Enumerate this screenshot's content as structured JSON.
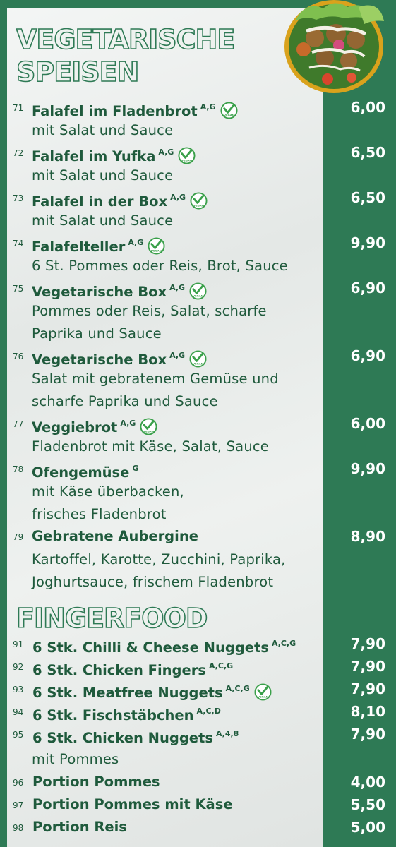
{
  "sections": {
    "vegetarian": {
      "title_line1": "VEGETARISCHE",
      "title_line2": "SPEISEN"
    },
    "fingerfood": {
      "title": "FINGERFOOD"
    }
  },
  "vegan_badge": "VEGAN",
  "vegetarian_items": [
    {
      "num": "71",
      "name": "Falafel im Fladenbrot",
      "allergens": "A,G",
      "vegan": true,
      "price": "6,00",
      "desc": [
        "mit Salat und Sauce"
      ]
    },
    {
      "num": "72",
      "name": "Falafel im Yufka",
      "allergens": "A,G",
      "vegan": true,
      "price": "6,50",
      "desc": [
        "mit Salat und Sauce"
      ]
    },
    {
      "num": "73",
      "name": "Falafel in der Box",
      "allergens": "A,G",
      "vegan": true,
      "price": "6,50",
      "desc": [
        "mit Salat und Sauce"
      ]
    },
    {
      "num": "74",
      "name": "Falafelteller",
      "allergens": "A,G",
      "vegan": true,
      "price": "9,90",
      "desc": [
        "6 St. Pommes oder Reis, Brot, Sauce"
      ]
    },
    {
      "num": "75",
      "name": "Vegetarische Box",
      "allergens": "A,G",
      "vegan": true,
      "price": "6,90",
      "desc": [
        "Pommes oder Reis, Salat, scharfe",
        "Paprika und Sauce"
      ]
    },
    {
      "num": "76",
      "name": "Vegetarische Box",
      "allergens": "A,G",
      "vegan": true,
      "price": "6,90",
      "desc": [
        "Salat mit gebratenem Gemüse und",
        "scharfe Paprika und Sauce"
      ]
    },
    {
      "num": "77",
      "name": "Veggiebrot",
      "allergens": "A,G",
      "vegan": true,
      "price": "6,00",
      "desc": [
        "Fladenbrot mit Käse, Salat, Sauce"
      ]
    },
    {
      "num": "78",
      "name": "Ofengemüse",
      "allergens": "G",
      "vegan": false,
      "price": "9,90",
      "desc": [
        "mit Käse überbacken,",
        "frisches Fladenbrot"
      ]
    },
    {
      "num": "79",
      "name": "Gebratene Aubergine",
      "allergens": "",
      "vegan": false,
      "price": "8,90",
      "desc": [
        "Kartoffel, Karotte, Zucchini, Paprika,",
        "Joghurtsauce, frischem Fladenbrot"
      ]
    }
  ],
  "fingerfood_items": [
    {
      "num": "91",
      "name": "6 Stk. Chilli & Cheese Nuggets",
      "allergens": "A,C,G",
      "vegan": false,
      "price": "7,90",
      "desc": []
    },
    {
      "num": "92",
      "name": "6 Stk. Chicken Fingers",
      "allergens": "A,C,G",
      "vegan": false,
      "price": "7,90",
      "desc": []
    },
    {
      "num": "93",
      "name": "6 Stk. Meatfree Nuggets",
      "allergens": "A,C,G",
      "vegan": true,
      "price": "7,90",
      "desc": []
    },
    {
      "num": "94",
      "name": "6 Stk. Fischstäbchen",
      "allergens": "A,C,D",
      "vegan": false,
      "price": "8,10",
      "desc": []
    },
    {
      "num": "95",
      "name": "6 Stk. Chicken Nuggets",
      "allergens": "A,4,8",
      "vegan": false,
      "price": "7,90",
      "desc": [
        "mit Pommes"
      ]
    },
    {
      "num": "96",
      "name": "Portion Pommes",
      "allergens": "",
      "vegan": false,
      "price": "4,00",
      "desc": []
    },
    {
      "num": "97",
      "name": "Portion Pommes mit Käse",
      "allergens": "",
      "vegan": false,
      "price": "5,50",
      "desc": []
    },
    {
      "num": "98",
      "name": "Portion Reis",
      "allergens": "",
      "vegan": false,
      "price": "5,00",
      "desc": []
    }
  ],
  "colors": {
    "brand_green": "#2e7a55",
    "text_green": "#1f5a3c",
    "badge_green": "#3aa04a",
    "price_text": "#ffffff"
  }
}
